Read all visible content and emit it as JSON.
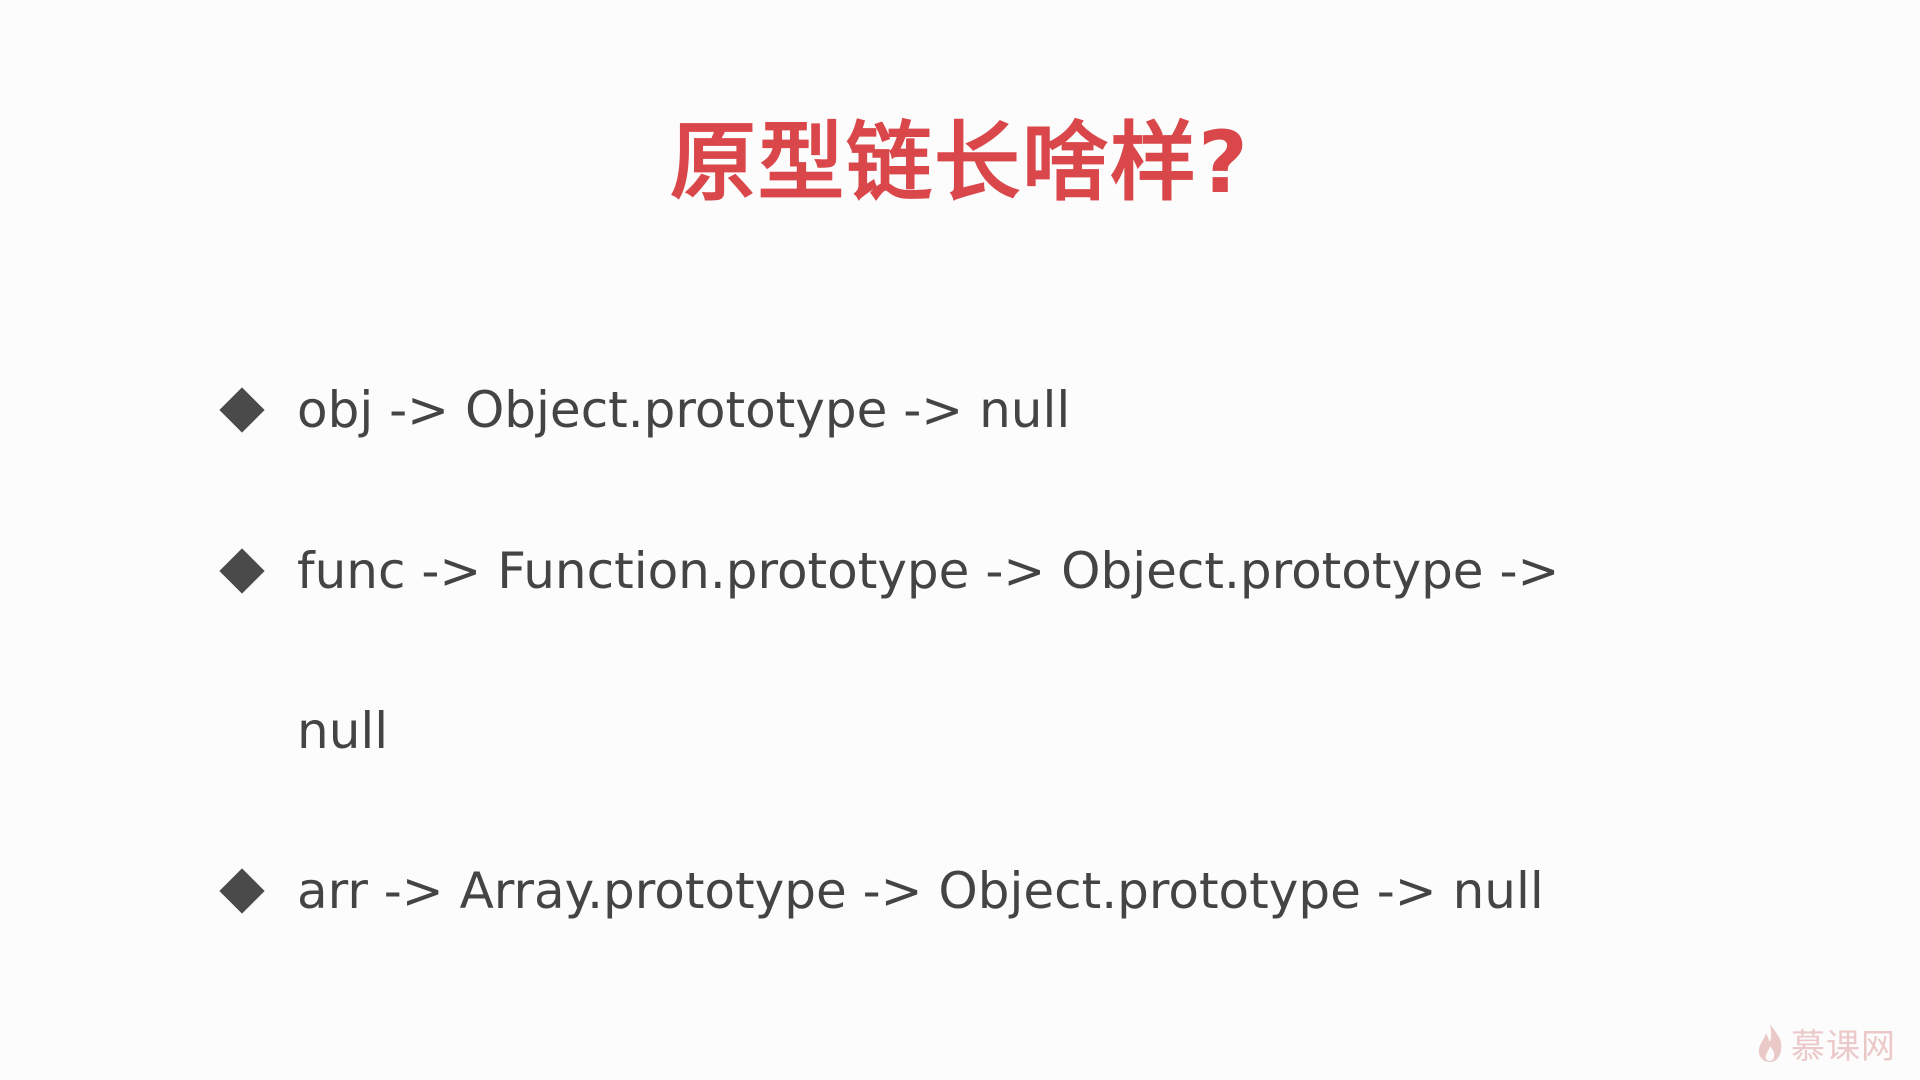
{
  "slide": {
    "title": "原型链长啥样?"
  },
  "bullets": [
    {
      "text": "obj -> Object.prototype -> null"
    },
    {
      "text": "func -> Function.prototype -> Object.prototype ->",
      "continuation": "null"
    },
    {
      "text": "arr -> Array.prototype -> Object.prototype -> null"
    }
  ],
  "watermark": {
    "text": "慕课网",
    "icon": "flame-logo-icon",
    "color": "#e0a0a0"
  },
  "colors": {
    "title": "#d9474a",
    "body_text": "#444444",
    "bullet_marker": "#4a4a4a",
    "background": "#fcfcfc"
  }
}
